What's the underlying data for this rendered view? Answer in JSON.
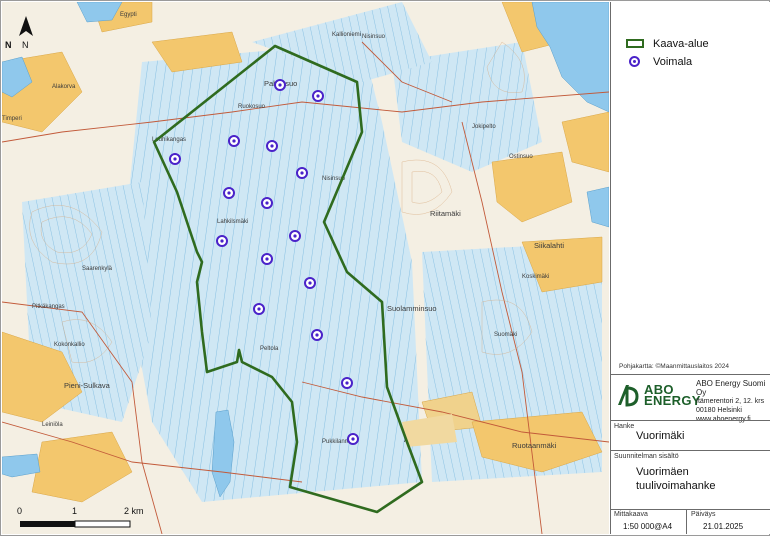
{
  "legend": {
    "items": [
      {
        "label": "Kaava-alue",
        "icon": "area-outline-icon",
        "color": "#2f6b1f"
      },
      {
        "label": "Voimala",
        "icon": "turbine-point-icon",
        "color": "#4a22c9"
      }
    ]
  },
  "map": {
    "north_label": "N",
    "scale_labels": [
      "0",
      "1",
      "2 km"
    ],
    "places": [
      "Egypti",
      "Pahkasuo",
      "Ruokosuo",
      "Nisinsuo",
      "Riitamäki",
      "Siikalahti",
      "Suolamminsuo",
      "Suomäki",
      "Pieni-Sulkava",
      "Alasuo",
      "Ruotaanmäki",
      "Leiniöla",
      "Kokonkallio",
      "Louhikangas",
      "Lahkilsmäki",
      "Jokipelto",
      "Peltola",
      "Nisinsuo",
      "Ostinsuo",
      "Pitkäkangas",
      "Timperi",
      "Alakorva",
      "Pukkilanmaa",
      "Kallioniemi",
      "Koskimäki",
      "Saarenkylä"
    ],
    "colors": {
      "water": "#8fc8ec",
      "field": "#f3c76d",
      "mire": "#c9e4f3",
      "forest": "#f4efe3",
      "boundary": "#2f6b1f",
      "turbine": "#4a22c9"
    }
  },
  "basemap_note": "Pohjakartta: ©Maanmittauslaitos 2024",
  "company": {
    "logo_line1": "ABO",
    "logo_line2": "ENERGY",
    "name": "ABO Energy Suomi Oy",
    "address1": "Itämerentori 2, 12. krs",
    "address2": "00180 Helsinki",
    "web": "www.aboenergy.fi"
  },
  "project": {
    "label": "Hanke",
    "value": "Vuorimäki"
  },
  "content": {
    "label": "Suunnitelman sisältö",
    "line1": "Vuorimäen",
    "line2": "tuulivoimahanke"
  },
  "scale": {
    "label": "Mittakaava",
    "value": "1:50 000@A4"
  },
  "date": {
    "label": "Päiväys",
    "value": "21.01.2025"
  }
}
